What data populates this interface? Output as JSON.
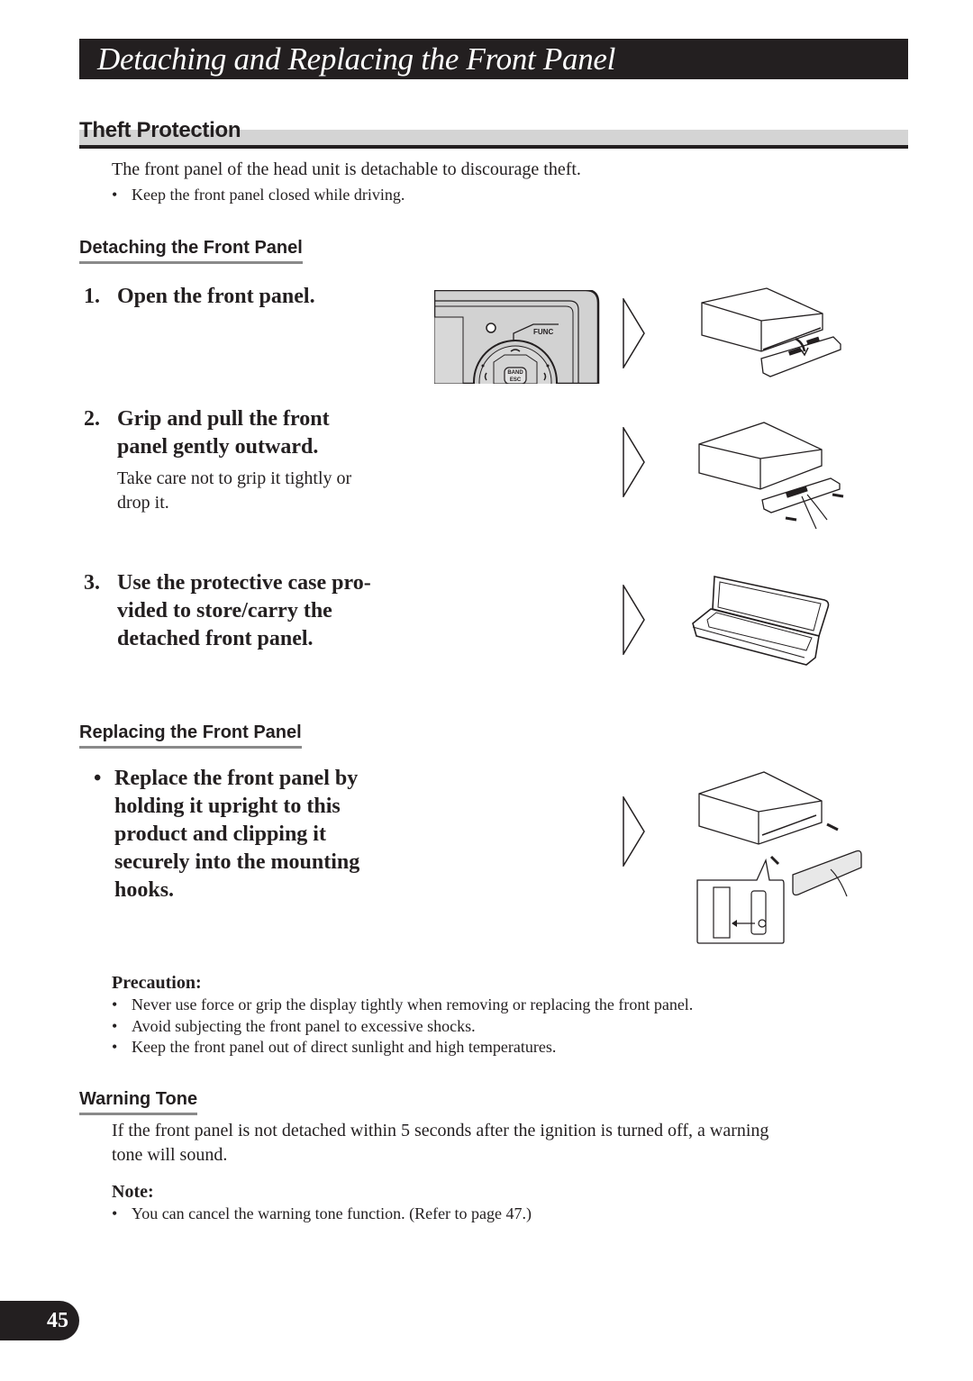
{
  "header": {
    "title": "Detaching and Replacing the Front Panel"
  },
  "theft_protection": {
    "heading": "Theft Protection",
    "intro": "The front panel of the head unit is detachable to discourage theft.",
    "bullets": [
      "Keep the front panel closed while driving."
    ]
  },
  "detaching": {
    "heading": "Detaching the Front Panel",
    "steps": [
      {
        "number": "1.",
        "lines": [
          "Open the front panel."
        ],
        "detail": []
      },
      {
        "number": "2.",
        "lines": [
          "Grip and pull the front",
          "panel gently outward."
        ],
        "detail": [
          "Take care not to grip it tightly or",
          "drop it."
        ]
      },
      {
        "number": "3.",
        "lines": [
          "Use the protective case pro-",
          "vided to store/carry the",
          "detached front panel."
        ],
        "detail": []
      }
    ],
    "illustration_labels": {
      "func": "FUNC",
      "band": "BAND",
      "esc": "ESC"
    }
  },
  "replacing": {
    "heading": "Replacing the Front Panel",
    "bullet_lines": [
      "Replace the front panel by",
      "holding it upright to this",
      "product and clipping it",
      "securely into the mounting",
      "hooks."
    ]
  },
  "precaution": {
    "heading": "Precaution:",
    "bullets": [
      "Never use force or grip the display tightly when removing or replacing the front panel.",
      "Avoid subjecting the front panel to excessive shocks.",
      "Keep the front panel out of direct sunlight and high temperatures."
    ]
  },
  "warning_tone": {
    "heading": "Warning Tone",
    "body_lines": [
      "If the front panel is not detached within 5 seconds after the ignition is turned off, a warning",
      "tone will sound."
    ],
    "note_heading": "Note:",
    "note_bullets": [
      "You can cancel the warning tone function. (Refer to page 47.)"
    ]
  },
  "footer": {
    "page_number": "45"
  },
  "bullet_char": "•"
}
